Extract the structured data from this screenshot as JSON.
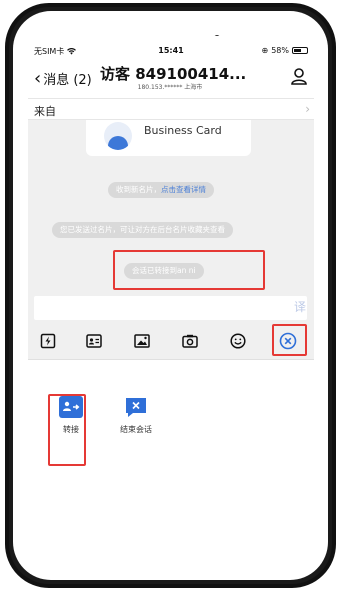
{
  "status_bar": {
    "carrier": "无SIM卡",
    "time": "15:41",
    "battery": "58%",
    "battery_level": 0.58
  },
  "nav": {
    "back_label": "消息 (2)",
    "title": "访客 849100414...",
    "subtitle": "180.153.****** 上海市"
  },
  "source": {
    "label": "来自",
    "arrow": "›"
  },
  "chat": {
    "card_label": "Business Card",
    "system_1_text": "收到新名片，",
    "system_1_link": "点击查看详情",
    "system_2": "您已发送过名片，可让对方在后台名片收藏夹查看",
    "system_3": "会话已转接到an ni"
  },
  "input": {
    "value": "",
    "translate": "译"
  },
  "toolbar": {
    "tools": [
      {
        "icon": "quick-reply-icon"
      },
      {
        "icon": "business-card-icon"
      },
      {
        "icon": "image-icon"
      },
      {
        "icon": "camera-icon"
      },
      {
        "icon": "emoji-icon"
      },
      {
        "icon": "close-panel-icon"
      }
    ]
  },
  "panel": {
    "items": [
      {
        "label": "转接",
        "icon": "transfer-icon",
        "color": "#2f6fd8"
      },
      {
        "label": "结束会话",
        "icon": "end-chat-icon",
        "color": "#2f6fd8"
      }
    ]
  },
  "colors": {
    "accent": "#2f6fd8",
    "highlight": "#e53935",
    "chat_bg": "#f0f0f0"
  }
}
